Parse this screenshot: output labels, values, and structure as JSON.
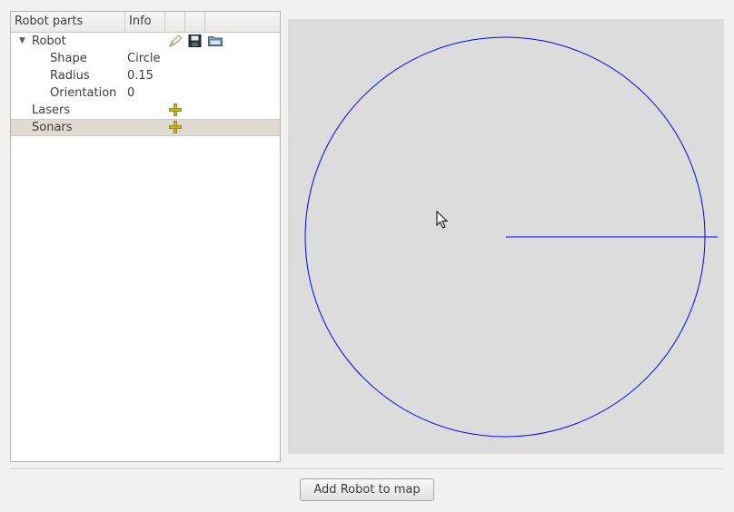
{
  "tree": {
    "headers": {
      "col1": "Robot parts",
      "col2": "Info",
      "col3": "",
      "col4": ""
    },
    "rows": [
      {
        "name": "Robot",
        "info": "",
        "expanded": true,
        "level": 0
      },
      {
        "name": "Shape",
        "info": "Circle",
        "level": 1
      },
      {
        "name": "Radius",
        "info": "0.15",
        "level": 1
      },
      {
        "name": "Orientation",
        "info": "0",
        "level": 1
      },
      {
        "name": "Lasers",
        "info": "",
        "level": 0
      },
      {
        "name": "Sonars",
        "info": "",
        "level": 0,
        "selected": true
      }
    ],
    "robot_icons": [
      "edit-icon",
      "save-icon",
      "open-folder-icon"
    ],
    "add_icon": "add-plus-icon"
  },
  "canvas": {
    "background": "#dcdcdc",
    "shape_color": "#0000ff"
  },
  "add_button": {
    "label": "Add Robot to map"
  }
}
